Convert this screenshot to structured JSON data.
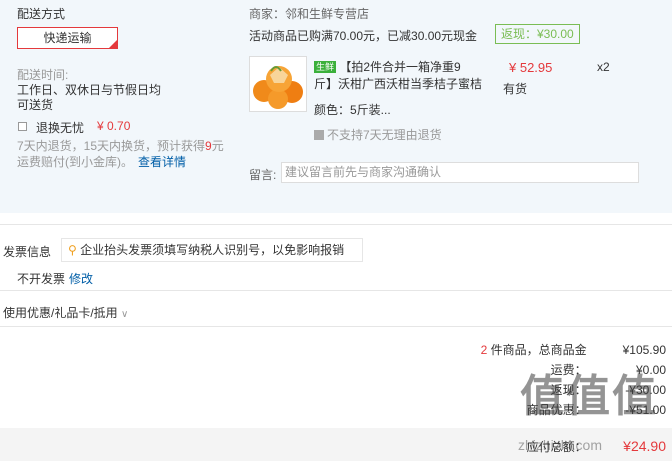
{
  "delivery": {
    "title": "配送方式",
    "method": "快递运输",
    "time_label": "配送时间:",
    "time_value_line1": "工作日、双休日与节假日均",
    "time_value_line2": "可送货",
    "insurance_label": "退换无忧",
    "insurance_price": "¥ 0.70",
    "insurance_desc_line1": "7天内退货，15天内换货，预计获得",
    "insurance_desc_num": "9",
    "insurance_desc_unit": "元",
    "insurance_desc_line2": "运费赔付(到小金库)。",
    "details_link": "查看详情"
  },
  "shop": {
    "label": "商家：邻和生鲜专营店",
    "promo": "活动商品已购满70.00元，已减30.00元现金",
    "rebate": "返现：¥30.00",
    "fresh_tag": "生鲜",
    "product_name_line1": "【拍2件合并一箱净重9",
    "product_name_line2": "斤】沃柑广西沃柑当季桔子蜜桔",
    "price": "¥ 52.95",
    "quantity": "x2",
    "stock": "有货",
    "color": "颜色：5斤装...",
    "return_policy": "不支持7天无理由退货",
    "note_label": "留言:",
    "note_placeholder": "建议留言前先与商家沟通确认"
  },
  "invoice": {
    "title": "发票信息",
    "tip": "企业抬头发票须填写纳税人识别号，以免影响报销",
    "value": "不开发票",
    "edit_link": "修改"
  },
  "coupons": {
    "label": "使用优惠/礼品卡/抵用"
  },
  "summary": {
    "count": "2",
    "count_text": "件商品，总商品金",
    "total": "¥105.90",
    "shipping_label": "运费：",
    "shipping_value": "¥0.00",
    "discount_label": "返现：",
    "discount_value": "-¥30.00",
    "promo_label": "商品优惠：",
    "promo_value": "-¥51.00",
    "pay_label": "应付总额：",
    "pay_value": "¥24.90"
  },
  "watermark": "值值值",
  "watermark_site": "zhizhizhi.com"
}
